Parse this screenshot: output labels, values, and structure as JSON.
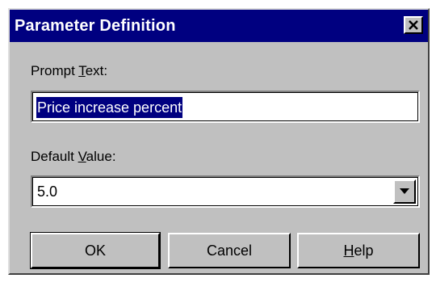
{
  "dialog": {
    "title": "Parameter Definition"
  },
  "prompt": {
    "label_before": "Prompt ",
    "label_mnemonic": "T",
    "label_after": "ext:",
    "value": "Price increase percent"
  },
  "default": {
    "label_before": "Default ",
    "label_mnemonic": "V",
    "label_after": "alue:",
    "value": "5.0"
  },
  "buttons": {
    "ok": "OK",
    "cancel": "Cancel",
    "help_mnemonic": "H",
    "help_rest": "elp"
  },
  "icons": {
    "close": "close-icon",
    "dropdown": "chevron-down-icon"
  }
}
